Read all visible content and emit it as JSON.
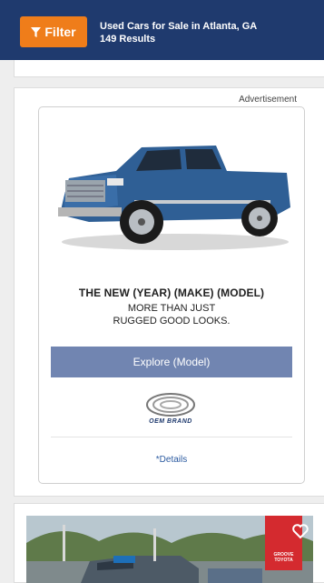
{
  "header": {
    "filter_label": "Filter",
    "title": "Used Cars for Sale in Atlanta, GA",
    "results": "149 Results"
  },
  "ad": {
    "label": "Advertisement",
    "headline": "THE NEW (YEAR) (MAKE) (MODEL)",
    "tagline_line1": "MORE THAN JUST",
    "tagline_line2": "RUGGED GOOD LOOKS.",
    "cta_label": "Explore (Model)",
    "brand_text": "OEM BRAND",
    "details_link": "*Details"
  },
  "listing": {
    "dealer_logo_text": "GROOVE TOYOTA"
  },
  "colors": {
    "header_bg": "#1f3a6e",
    "filter_bg": "#ef7d1a",
    "cta_bg": "#7185b1",
    "link": "#2b5aa0",
    "dealer_red": "#d42a2f"
  },
  "icons": {
    "filter": "filter-funnel-icon",
    "favorite": "heart-icon"
  }
}
